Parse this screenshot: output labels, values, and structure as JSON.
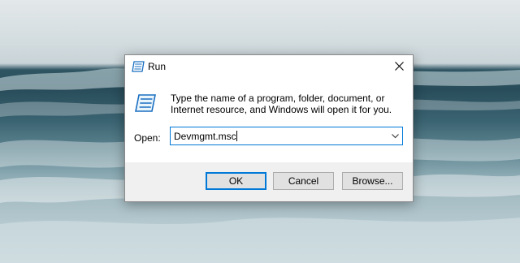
{
  "dialog": {
    "title": "Run",
    "close_glyph": "✕",
    "description": "Type the name of a program, folder, document, or Internet resource, and Windows will open it for you.",
    "open_label": "Open:",
    "open_value": "Devmgmt.msc",
    "buttons": {
      "ok": "OK",
      "cancel": "Cancel",
      "browse": "Browse..."
    }
  },
  "icons": [
    "run-icon",
    "close-icon",
    "run-large-icon",
    "dropdown-arrow-icon"
  ],
  "colors": {
    "focus_blue": "#0078d7",
    "button_bar": "#f0f0f0",
    "button_face": "#e1e1e1",
    "dialog_bg": "#ffffff"
  }
}
